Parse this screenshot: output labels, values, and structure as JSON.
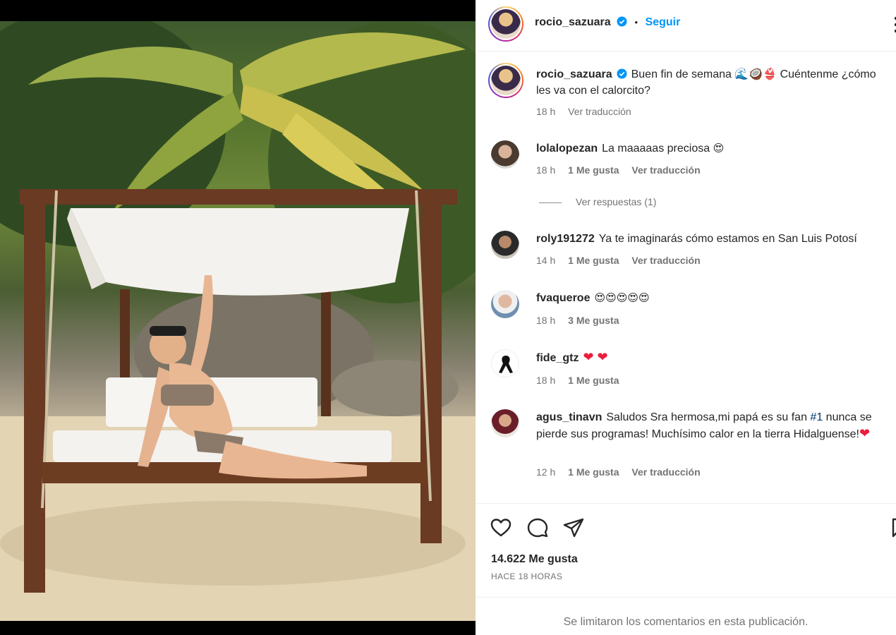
{
  "post": {
    "username": "rocio_sazuara",
    "follow_label": "Seguir",
    "dot": "•",
    "caption": "Buen fin de semana 🌊🥥👙 Cuéntenme ¿cómo les va con el calorcito?",
    "caption_time": "18 h",
    "translate_label": "Ver traducción",
    "likes": "14.622 Me gusta",
    "posted_ago": "HACE 18 HORAS",
    "comments_limited": "Se limitaron los comentarios en esta publicación."
  },
  "comments": [
    {
      "username": "lolalopezan",
      "text": "La maaaaas preciosa",
      "emoji": "😍",
      "time": "18 h",
      "likes": "1 Me gusta",
      "translate": "Ver traducción",
      "replies": "Ver respuestas (1)"
    },
    {
      "username": "roly191272",
      "text": "Ya te imaginarás cómo estamos en San Luis Potosí",
      "time": "14 h",
      "likes": "1 Me gusta",
      "translate": "Ver traducción"
    },
    {
      "username": "fvaqueroe",
      "emoji": "😍😍😍😍😍",
      "time": "18 h",
      "likes": "3 Me gusta"
    },
    {
      "username": "fide_gtz",
      "emoji": "❤ ❤",
      "time": "18 h",
      "likes": "1 Me gusta"
    },
    {
      "username": "agus_tinavn",
      "text_before": "Saludos Sra hermosa,mi papá es su fan",
      "hashtag": "#1",
      "text_after": "nunca se pierde sus programas! Muchísimo calor en la tierra Hidalguense!",
      "emoji": "❤",
      "time": "12 h",
      "likes": "1 Me gusta",
      "translate": "Ver traducción"
    }
  ],
  "colors": {
    "accent": "#0095f6",
    "muted": "#737373",
    "heart": "#ed1c3c",
    "verified": "#0095f6"
  },
  "icons": [
    "verified-badge-icon",
    "more-options-icon",
    "heart-icon",
    "comment-icon",
    "share-icon",
    "bookmark-icon"
  ]
}
